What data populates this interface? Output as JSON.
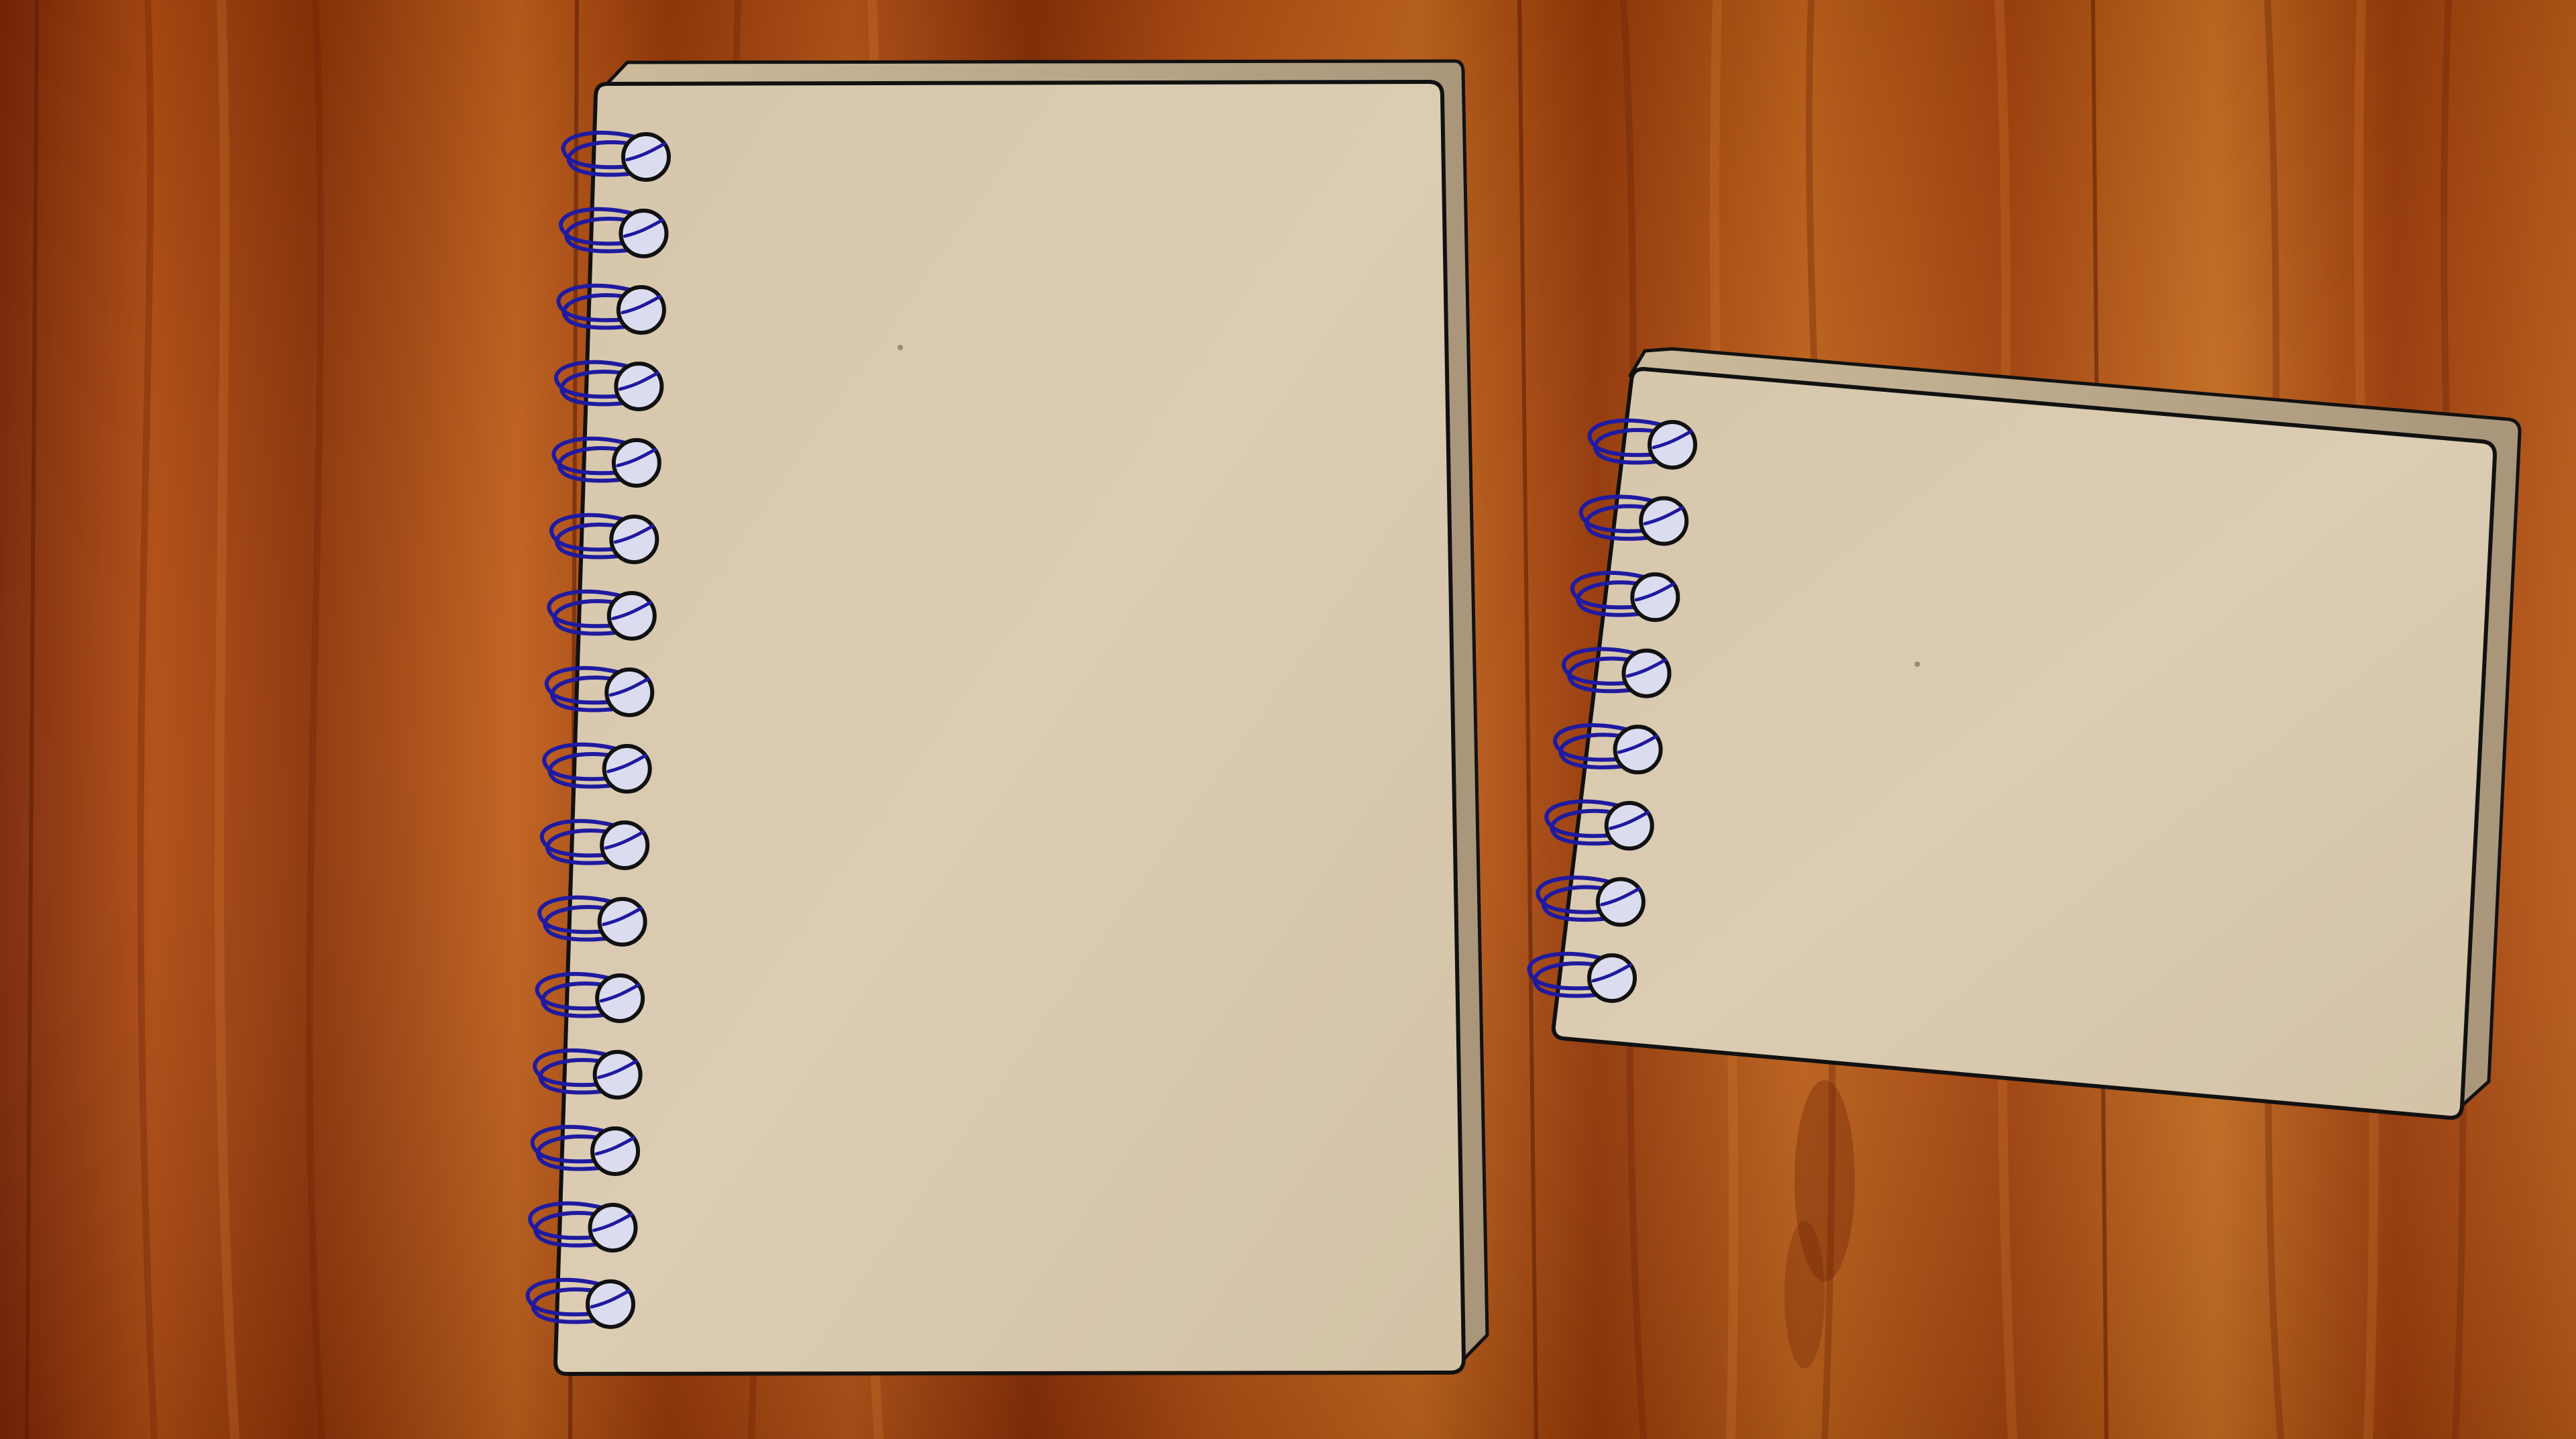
{
  "scene": {
    "description_free": true
  },
  "palette": {
    "wood_dark": "#7a2a06",
    "wood_mid": "#a8450f",
    "wood_light": "#c8651c",
    "paper": "#d8c8ae",
    "paper_edge": "#b9a68a",
    "outline": "#111111",
    "spiral": "#1f1aa0",
    "ring_hole": "#dcdcf0"
  },
  "notebooks": [
    {
      "name": "large-spiral-notebook",
      "orientation": "portrait",
      "ring_count": 16,
      "blank": true
    },
    {
      "name": "small-spiral-notebook",
      "orientation": "landscape-tilted",
      "ring_count": 8,
      "blank": true
    }
  ]
}
